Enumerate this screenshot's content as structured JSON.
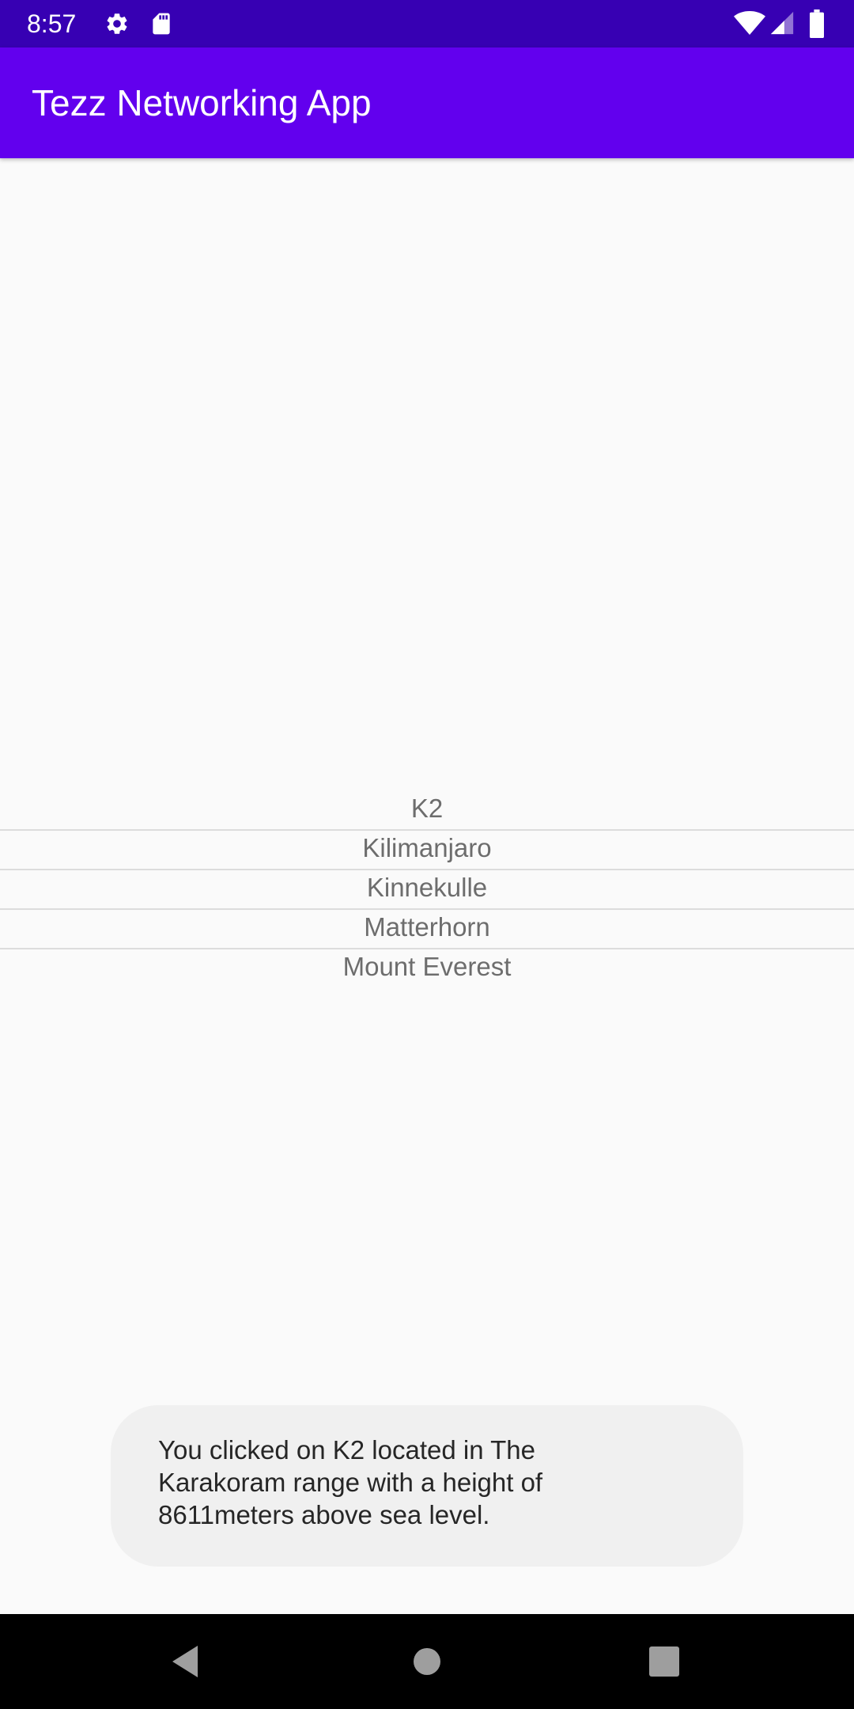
{
  "status_bar": {
    "time": "8:57",
    "icons_left": [
      "gear-icon",
      "sd-card-icon"
    ],
    "icons_right": [
      "wifi-icon",
      "cell-signal-icon",
      "battery-icon"
    ]
  },
  "app_bar": {
    "title": "Tezz Networking App"
  },
  "mountains": [
    "K2",
    "Kilimanjaro",
    "Kinnekulle",
    "Matterhorn",
    "Mount Everest"
  ],
  "toast": {
    "message": "You clicked on K2 located in The Karakoram range with a height of 8611meters above sea level."
  },
  "nav_bar": {
    "buttons": [
      "back-icon",
      "home-icon",
      "recents-icon"
    ]
  },
  "colors": {
    "status_bar": "#3700b3",
    "app_bar": "#6200ee",
    "background": "#fafafa",
    "list_text": "#6d6d6d",
    "toast_bg": "#f0f0f0"
  }
}
